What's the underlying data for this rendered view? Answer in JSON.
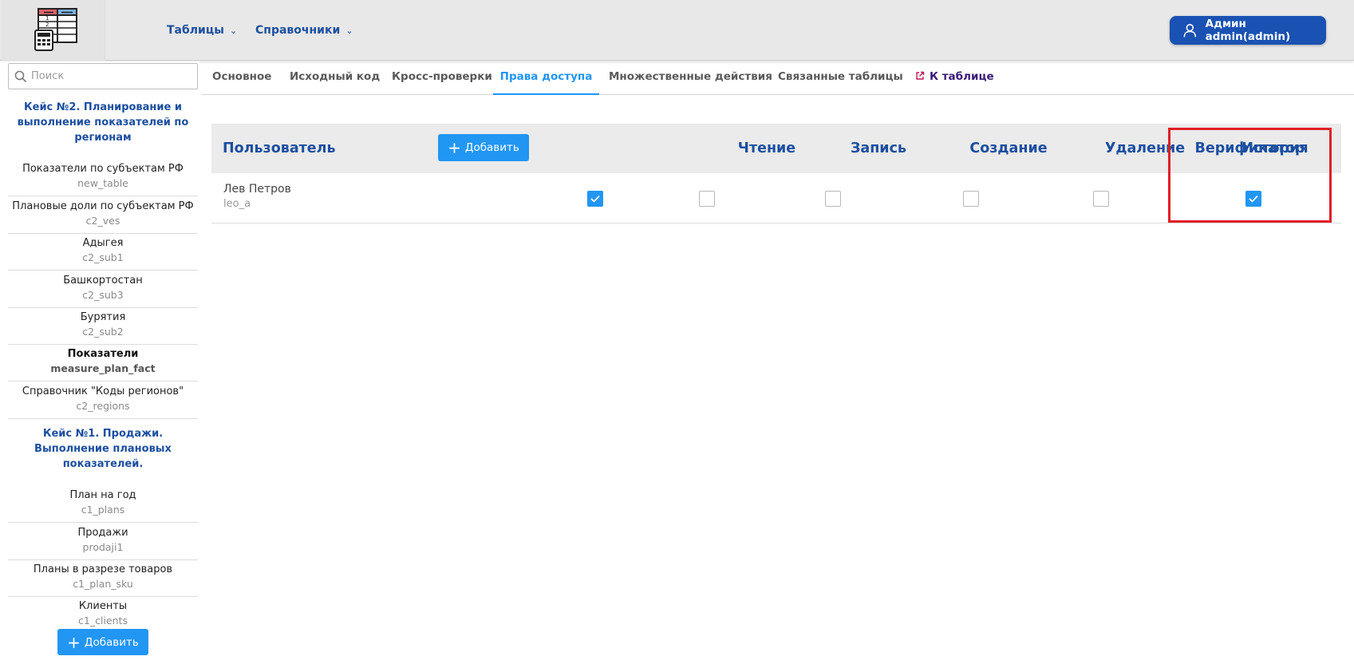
{
  "header": {
    "logo_icon": "spreadsheet-calculator-icon",
    "nav": [
      {
        "label": "Таблицы",
        "icon": "chevron-down-icon"
      },
      {
        "label": "Справочники",
        "icon": "chevron-down-icon"
      }
    ],
    "user_button": {
      "label": "Админ admin(admin)",
      "icon": "user-icon"
    }
  },
  "sidebar": {
    "search": {
      "placeholder": "Поиск",
      "value": "",
      "icon": "search-icon"
    },
    "sections": [
      {
        "title": "Кейс №2. Планирование и выполнение показателей по регионам",
        "items": [
          {
            "title": "Показатели по субъектам РФ",
            "code": "new_table"
          },
          {
            "title": "Плановые доли по субъектам РФ",
            "code": "c2_ves"
          },
          {
            "title": "Адыгея",
            "code": "c2_sub1"
          },
          {
            "title": "Башкортостан",
            "code": "c2_sub3"
          },
          {
            "title": "Бурятия",
            "code": "c2_sub2"
          },
          {
            "title": "Показатели",
            "code": "measure_plan_fact",
            "active": true
          },
          {
            "title": "Справочник \"Коды регионов\"",
            "code": "c2_regions"
          }
        ]
      },
      {
        "title": "Кейс №1. Продажи. Выполнение плановых показателей.",
        "items": [
          {
            "title": "План на год",
            "code": "c1_plans"
          },
          {
            "title": "Продажи",
            "code": "prodaji1"
          },
          {
            "title": "Планы в разрезе товаров",
            "code": "c1_plan_sku"
          },
          {
            "title": "Клиенты",
            "code": "c1_clients"
          }
        ]
      }
    ],
    "add_button": {
      "label": "Добавить",
      "icon": "plus-icon"
    }
  },
  "tabs": [
    {
      "label": "Основное"
    },
    {
      "label": "Исходный код"
    },
    {
      "label": "Кросс-проверки"
    },
    {
      "label": "Права доступа",
      "active": true
    },
    {
      "label": "Множественные действия"
    },
    {
      "label": "Связанные таблицы"
    },
    {
      "label": "К таблице",
      "icon": "external-link-icon"
    }
  ],
  "permissions": {
    "columns": {
      "user": "Пользователь",
      "add_button": "Добавить",
      "read": "Чтение",
      "write": "Запись",
      "create": "Создание",
      "delete": "Удаление",
      "history": "История",
      "verifier": "Верификатор"
    },
    "rows": [
      {
        "name": "Лев Петров",
        "login": "leo_a",
        "read": true,
        "write": false,
        "create": false,
        "delete": false,
        "history": false,
        "verifier": true
      }
    ]
  },
  "colors": {
    "accent": "#2196f3",
    "brand_dark": "#1a52b3",
    "heading_blue": "#1c4fa0",
    "highlight_red": "#e01f26",
    "header_bg": "#e8e8e8"
  }
}
